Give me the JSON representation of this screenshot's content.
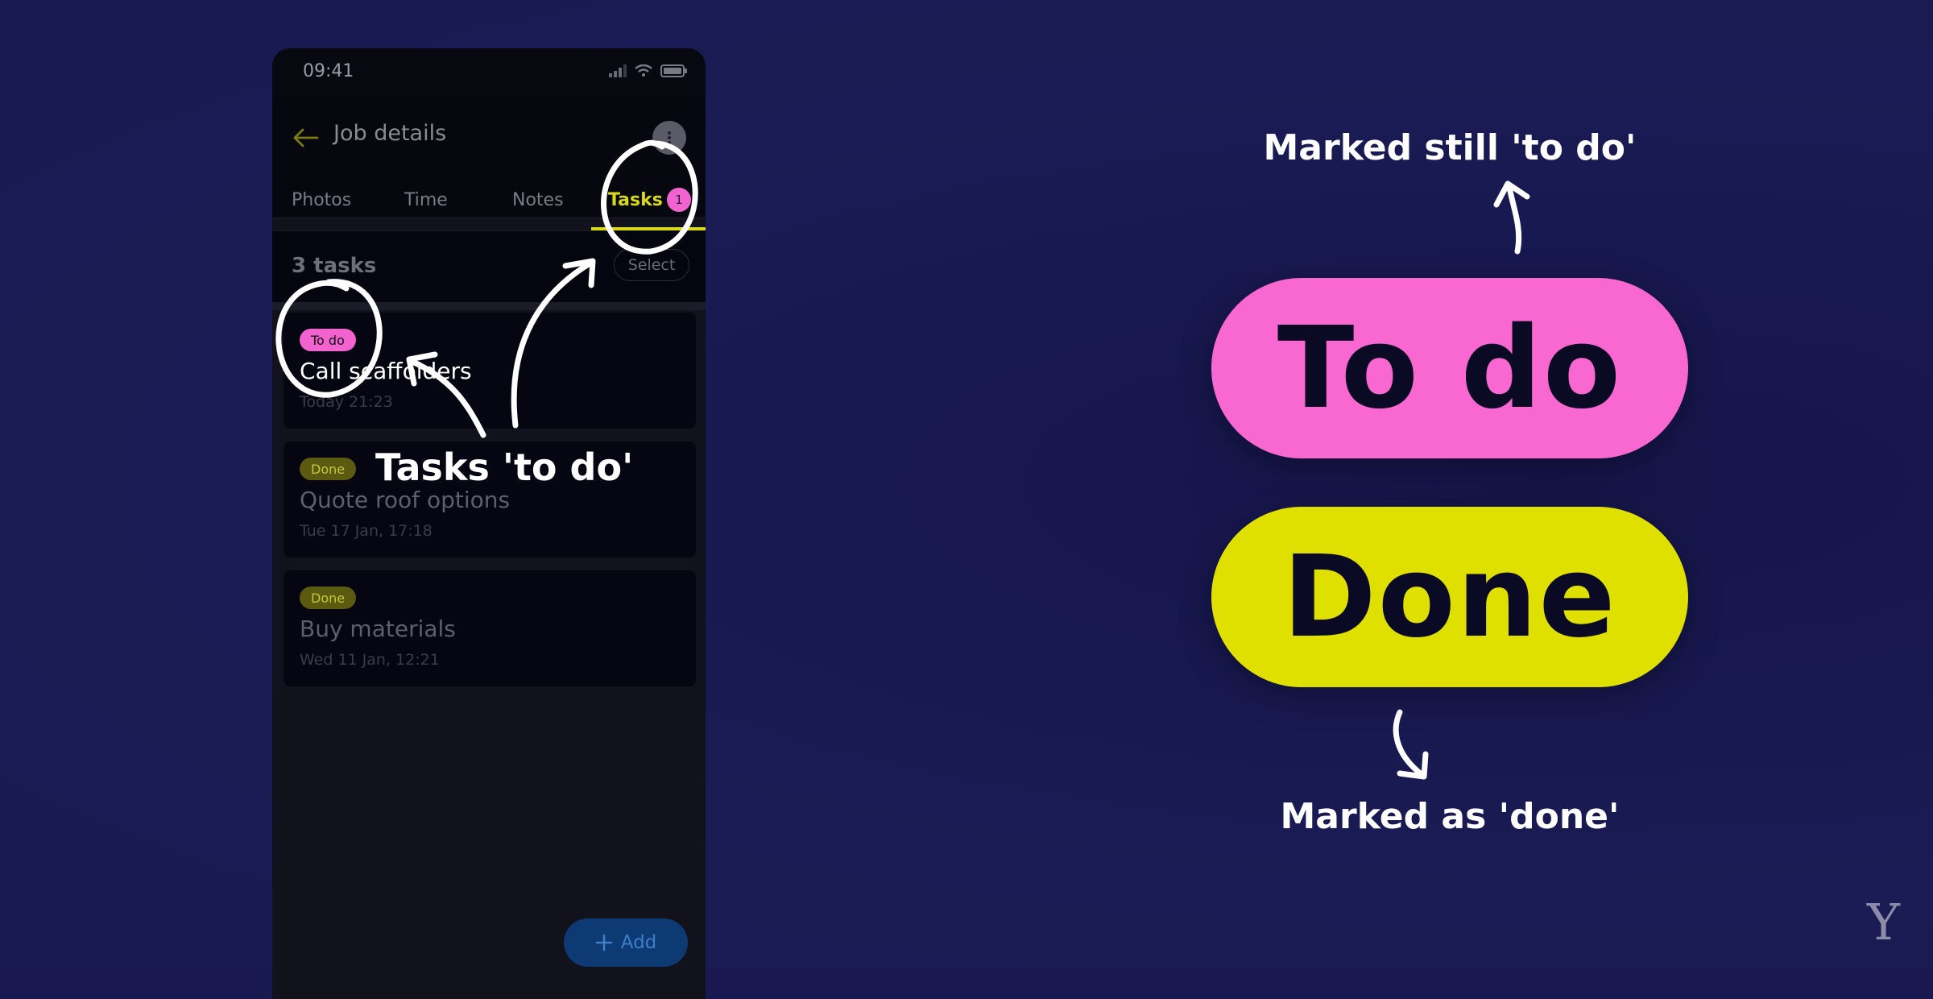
{
  "phone": {
    "status_time": "09:41",
    "header_title": "Job details",
    "tabs": [
      {
        "label": "Photos"
      },
      {
        "label": "Time"
      },
      {
        "label": "Notes"
      },
      {
        "label": "Tasks",
        "badge": "1"
      }
    ],
    "task_count": "3 tasks",
    "select_label": "Select",
    "tasks": [
      {
        "status": "To do",
        "title": "Call scaffolders",
        "time": "Today 21:23"
      },
      {
        "status": "Done",
        "title": "Quote roof options",
        "time": "Tue 17 Jan, 17:18"
      },
      {
        "status": "Done",
        "title": "Buy materials",
        "time": "Wed 11 Jan, 12:21"
      }
    ],
    "add_label": "Add"
  },
  "annotations": {
    "callout": "Tasks 'to do'",
    "caption_top": "Marked still 'to do'",
    "caption_bottom": "Marked as 'done'"
  },
  "legend": {
    "todo_label": "To do",
    "done_label": "Done"
  },
  "brand": {
    "logo_letter": "Y"
  },
  "colors": {
    "todo": "#f868d0",
    "done": "#dfdf00",
    "accent": "#d8d81a",
    "background": "#1a1a52"
  }
}
